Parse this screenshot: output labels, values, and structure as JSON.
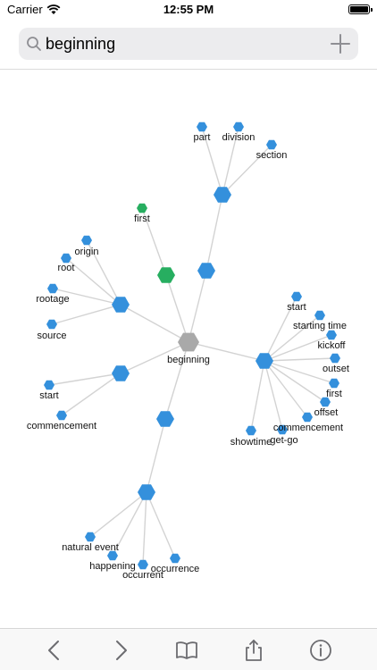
{
  "status": {
    "carrier": "Carrier",
    "time": "12:55 PM",
    "battery_level": 1.0
  },
  "search": {
    "value": "beginning",
    "placeholder": ""
  },
  "graph": {
    "center": "beginning",
    "colors": {
      "center": "#a9a9a9",
      "hub": "#3490dc",
      "leaf": "#3490dc",
      "highlight": "#27ae60",
      "edge": "#d3d3d3"
    },
    "labels": {
      "part": "part",
      "division": "division",
      "section": "section",
      "first_top": "first",
      "origin": "origin",
      "root": "root",
      "rootage": "rootage",
      "source": "source",
      "start_left": "start",
      "commencement_left": "commencement",
      "start_right": "start",
      "starting_time": "starting time",
      "kickoff": "kickoff",
      "outset": "outset",
      "first_right": "first",
      "offset": "offset",
      "commencement_right": "commencement",
      "showtime": "showtime",
      "get_go": "get-go",
      "natural_event": "natural event",
      "happening": "happening",
      "occurrence": "occurrence",
      "occurrent": "occurrent"
    }
  },
  "toolbar": {
    "icons": [
      "chevron-left-icon",
      "chevron-right-icon",
      "book-icon",
      "share-icon",
      "info-icon"
    ]
  }
}
